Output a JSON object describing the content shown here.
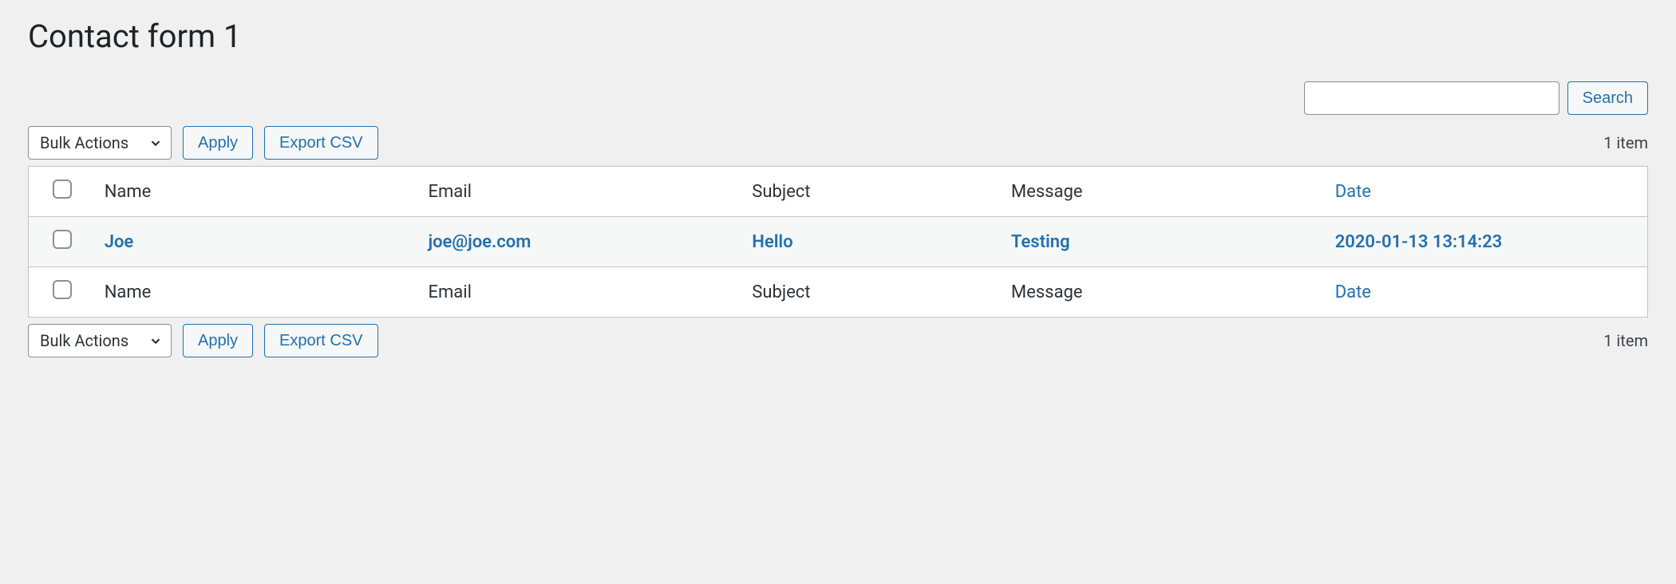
{
  "page": {
    "title": "Contact form 1"
  },
  "search": {
    "value": "",
    "button_label": "Search"
  },
  "tablenav_top": {
    "bulk_label": "Bulk Actions",
    "apply_label": "Apply",
    "export_label": "Export CSV",
    "items_text": "1 item"
  },
  "tablenav_bottom": {
    "bulk_label": "Bulk Actions",
    "apply_label": "Apply",
    "export_label": "Export CSV",
    "items_text": "1 item"
  },
  "table": {
    "columns": {
      "name": "Name",
      "email": "Email",
      "subject": "Subject",
      "message": "Message",
      "date": "Date"
    },
    "rows": [
      {
        "name": "Joe",
        "email": "joe@joe.com",
        "subject": "Hello",
        "message": "Testing",
        "date": "2020-01-13 13:14:23"
      }
    ]
  }
}
